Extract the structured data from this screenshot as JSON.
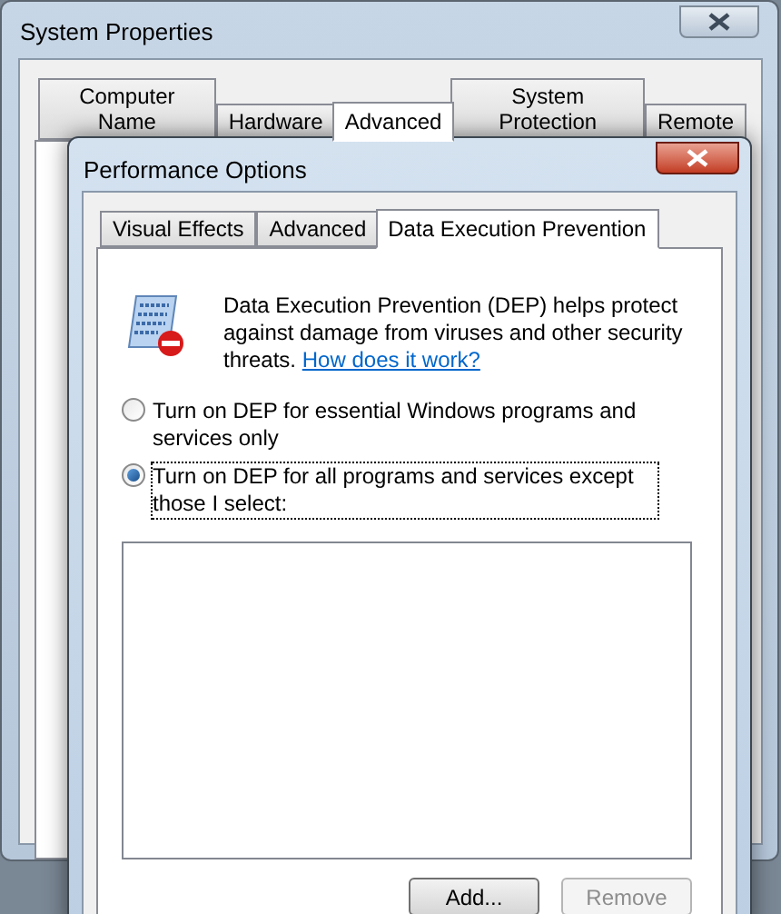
{
  "back_window": {
    "title": "System Properties",
    "tabs": [
      {
        "label": "Computer Name",
        "selected": false
      },
      {
        "label": "Hardware",
        "selected": false
      },
      {
        "label": "Advanced",
        "selected": true
      },
      {
        "label": "System Protection",
        "selected": false
      },
      {
        "label": "Remote",
        "selected": false
      }
    ]
  },
  "dialog": {
    "title": "Performance Options",
    "tabs": [
      {
        "label": "Visual Effects",
        "selected": false
      },
      {
        "label": "Advanced",
        "selected": false
      },
      {
        "label": "Data Execution Prevention",
        "selected": true
      }
    ],
    "description": "Data Execution Prevention (DEP) helps protect against damage from viruses and other security threats.",
    "help_link": "How does it work?",
    "options": [
      {
        "label": "Turn on DEP for essential Windows programs and services only",
        "selected": false,
        "focused": false
      },
      {
        "label": "Turn on DEP for all programs and services except those I select:",
        "selected": true,
        "focused": true
      }
    ],
    "buttons": [
      {
        "label": "Add...",
        "disabled": false
      },
      {
        "label": "Remove",
        "disabled": true
      }
    ]
  }
}
